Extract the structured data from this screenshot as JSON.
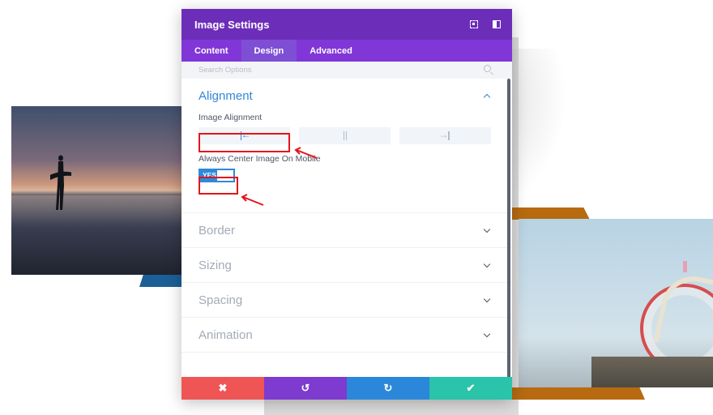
{
  "modal": {
    "title": "Image Settings",
    "header_icons": [
      "fullscreen-icon",
      "sidebar-toggle-icon"
    ]
  },
  "tabs": [
    {
      "label": "Content",
      "active": false
    },
    {
      "label": "Design",
      "active": true
    },
    {
      "label": "Advanced",
      "active": false
    }
  ],
  "search": {
    "placeholder": "Search Options"
  },
  "sections": {
    "alignment": {
      "title": "Alignment",
      "image_alignment_label": "Image Alignment",
      "alignment_options": [
        "left",
        "center",
        "right"
      ],
      "selected_alignment": "left",
      "center_mobile_label": "Always Center Image On Mobile",
      "center_mobile_value": "YES"
    },
    "border": {
      "title": "Border"
    },
    "sizing": {
      "title": "Sizing"
    },
    "spacing": {
      "title": "Spacing"
    },
    "animation": {
      "title": "Animation"
    }
  },
  "footer": {
    "discard_icon": "✖",
    "undo_icon": "↺",
    "redo_icon": "↻",
    "save_icon": "✔"
  },
  "colors": {
    "header": "#6c2eb9",
    "tabs": "#8137d8",
    "accent_blue": "#2f89d8",
    "highlight_red": "#e3151c",
    "discard": "#ef5555",
    "undo": "#7d3bcf",
    "redo": "#2b87da",
    "save": "#29c4a9"
  }
}
